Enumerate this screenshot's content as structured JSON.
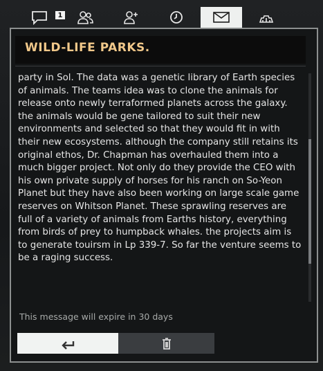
{
  "tabs": [
    {
      "name": "messages",
      "icon": "chat-bubble-icon",
      "badge": "1",
      "active": false
    },
    {
      "name": "friends",
      "icon": "users-icon",
      "active": false
    },
    {
      "name": "add-friend",
      "icon": "add-user-icon",
      "active": false
    },
    {
      "name": "history",
      "icon": "clock-icon",
      "active": false
    },
    {
      "name": "inbox",
      "icon": "envelope-icon",
      "active": true
    },
    {
      "name": "settings",
      "icon": "gear-icon",
      "active": false
    }
  ],
  "message": {
    "title": "WILD-LIFE PARKS.",
    "body": "party in Sol. The data was a genetic library of Earth species of animals. The teams idea was to clone the animals for release onto newly terraformed planets across the galaxy. the animals would be gene tailored to suit their new environments and selected so that they would fit in with their new ecosystems. although the company still retains its original ethos, Dr. Chapman has overhauled them into a much bigger project. Not only do they provide the CEO with his own private supply of horses for his ranch on So-Yeon Planet but they have also been working on large scale game reserves on Whitson Planet. These sprawling reserves are full of a variety of animals from Earths history, everything from birds of prey to humpback whales. the projects aim is to generate touirsm in Lp 339-7. So far the venture seems to be a raging success.",
    "expiry": "This message will expire in 30 days"
  },
  "actions": {
    "reply_icon": "reply-arrow-icon",
    "delete_icon": "trash-icon"
  },
  "colors": {
    "title": "#f1c88a",
    "active_tab": "#eef0ef",
    "panel_border": "#8d9090"
  }
}
